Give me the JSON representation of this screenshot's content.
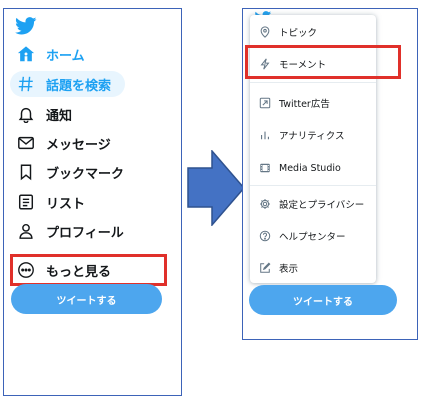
{
  "left_panel": {
    "nav": [
      {
        "label": "ホーム",
        "icon": "home-icon"
      },
      {
        "label": "話題を検索",
        "icon": "hashtag-icon"
      },
      {
        "label": "通知",
        "icon": "bell-icon"
      },
      {
        "label": "メッセージ",
        "icon": "envelope-icon"
      },
      {
        "label": "ブックマーク",
        "icon": "bookmark-icon"
      },
      {
        "label": "リスト",
        "icon": "list-icon"
      },
      {
        "label": "プロフィール",
        "icon": "person-icon"
      },
      {
        "label": "もっと見る",
        "icon": "more-circle-icon"
      }
    ],
    "tweet_button": "ツイートする"
  },
  "right_panel": {
    "menu": [
      {
        "label": "トピック",
        "icon": "topic-pin-icon"
      },
      {
        "label": "モーメント",
        "icon": "lightning-icon"
      },
      {
        "label": "Twitter広告",
        "icon": "ads-arrow-icon"
      },
      {
        "label": "アナリティクス",
        "icon": "bar-chart-icon"
      },
      {
        "label": "Media Studio",
        "icon": "film-icon"
      },
      {
        "label": "設定とプライバシー",
        "icon": "gear-icon"
      },
      {
        "label": "ヘルプセンター",
        "icon": "help-icon"
      },
      {
        "label": "表示",
        "icon": "edit-square-icon"
      }
    ],
    "tweet_button": "ツイートする"
  },
  "colors": {
    "brand_blue": "#1da1f2",
    "button_blue": "#4da6ee",
    "highlight_red": "#e0302a",
    "frame_blue": "#3d63b8",
    "arrow_blue": "#4472c4"
  }
}
